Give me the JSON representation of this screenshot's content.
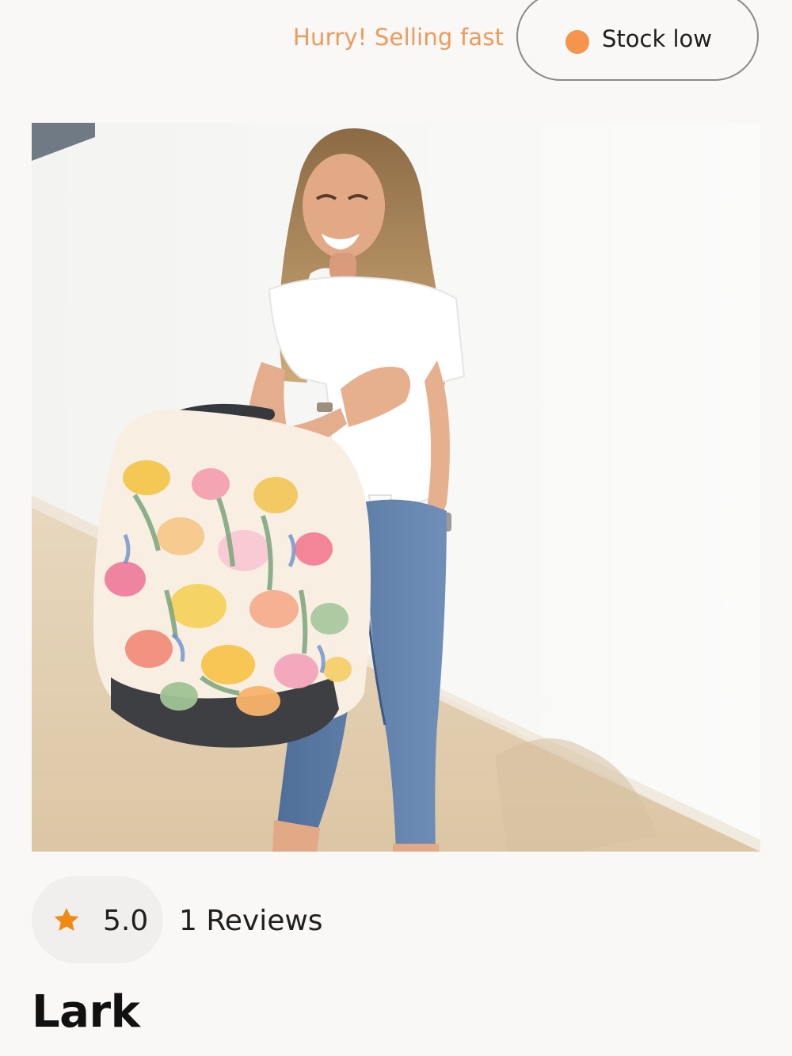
{
  "stock": {
    "urgency_text": "Hurry! Selling fast",
    "status_label": "Stock low",
    "status_color": "#f5944d",
    "urgency_color": "#ef9a5a"
  },
  "product": {
    "image": {
      "alt": ""
    },
    "rating": {
      "icon": "star-icon",
      "value": "5.0",
      "reviews_label": "1 Reviews",
      "star_color": "#f08a14"
    },
    "title": "Lark"
  }
}
